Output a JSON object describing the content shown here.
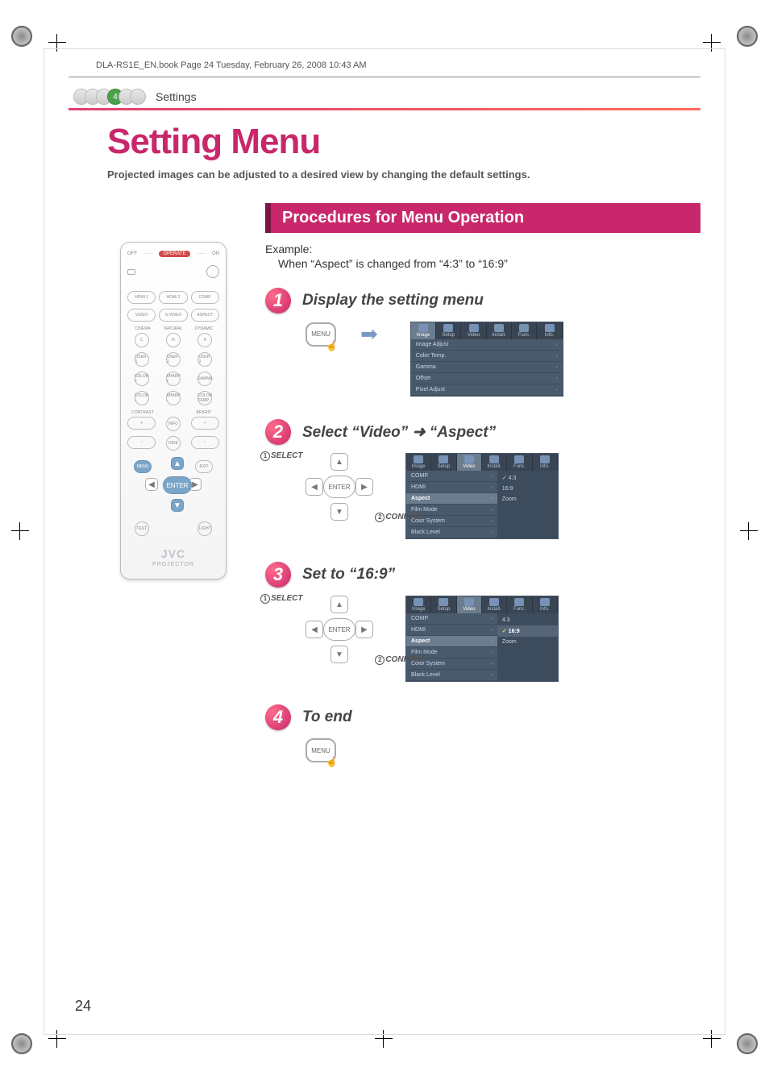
{
  "meta": {
    "book_line": "DLA-RS1E_EN.book  Page 24  Tuesday, February 26, 2008  10:43 AM"
  },
  "breadcrumb": {
    "section_num": "4",
    "section_name": "Settings"
  },
  "h1": "Setting Menu",
  "intro": "Projected images can be adjusted to a desired view by changing the default settings.",
  "banner": "Procedures for Menu Operation",
  "example": {
    "label": "Example:",
    "text": "When “Aspect” is changed from “4:3” to “16:9”"
  },
  "steps": {
    "s1": {
      "num": "1",
      "title": "Display the setting menu",
      "btn": "MENU"
    },
    "s2": {
      "num": "2",
      "title": "Select “Video” ➜ “Aspect”",
      "select": "SELECT",
      "confirm": "CONFIRM",
      "enter": "ENTER"
    },
    "s3": {
      "num": "3",
      "title": "Set to “16:9”",
      "select": "SELECT",
      "confirm": "CONFIRM",
      "enter": "ENTER"
    },
    "s4": {
      "num": "4",
      "title": "To end",
      "btn": "MENU"
    }
  },
  "osd_tabs": [
    "Image",
    "Setup",
    "Video",
    "Install.",
    "Func.",
    "Info."
  ],
  "osd1_rows": [
    "Image Adjust",
    "Color Temp.",
    "Gamma",
    "Offset",
    "Pixel Adjust"
  ],
  "osd2_rows": [
    "COMP.",
    "HDMI",
    "Aspect",
    "Film Mode",
    "Color System",
    "Black Level"
  ],
  "osd2_sub": [
    "4:3",
    "16:9",
    "Zoom"
  ],
  "osd3_rows": [
    "COMP.",
    "HDMI",
    "Aspect",
    "Film Mode",
    "Color System",
    "Black Level"
  ],
  "osd3_sub": [
    "4:3",
    "16:9",
    "Zoom"
  ],
  "remote": {
    "off": "OFF",
    "operate": "OPERATE",
    "on": "ON",
    "row_a": [
      "HDMI 1",
      "HDMI 2",
      "COMP."
    ],
    "row_b": [
      "VIDEO",
      "S-VIDEO",
      "ASPECT"
    ],
    "lab_c": [
      "CINEMA",
      "NATURAL",
      "DYNAMIC"
    ],
    "row_c": [
      "C",
      "N",
      "D"
    ],
    "row_d": [
      "USER 1",
      "USER 2",
      "USER 3"
    ],
    "row_e": [
      "COLOR +",
      "SHARP +",
      "GAMMA"
    ],
    "row_f": [
      "COLOR −",
      "SHARP −",
      "COLOR TEMP"
    ],
    "lab_g": [
      "CONTRAST",
      "",
      "BRIGHT"
    ],
    "row_g": [
      "+",
      "INFO",
      "+"
    ],
    "row_h": [
      "−",
      "HIDE",
      "−"
    ],
    "menu": "MENU",
    "exit": "EXIT",
    "enter": "ENTER",
    "row_last": [
      "TEST",
      "",
      "LIGHT"
    ],
    "brand": "JVC",
    "sub": "PROJECTOR"
  },
  "page_num": "24"
}
